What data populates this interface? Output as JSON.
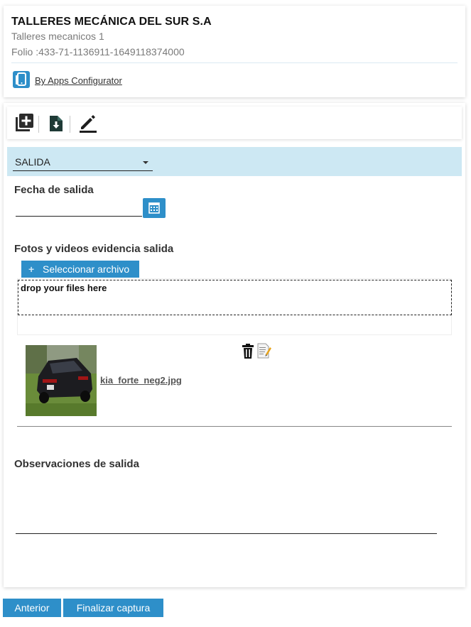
{
  "header": {
    "company_name": "TALLERES MECÁNICA DEL SUR S.A",
    "subtitle": "Talleres mecanicos 1",
    "folio": "Folio :433-71-1136911-1649118374000",
    "apps_link": "By Apps Configurator"
  },
  "toolbar": {
    "icons": [
      "add-box-icon",
      "download-file-icon",
      "edit-pen-icon"
    ]
  },
  "status": {
    "selected": "SALIDA"
  },
  "form": {
    "date_label": "Fecha de salida",
    "date_value": "",
    "photos_label": "Fotos y videos evidencia salida",
    "upload_button": "Seleccionar archivo",
    "dropzone_text": "drop your files here",
    "file_name": "kia_forte_neg2.jpg",
    "observations_label": "Observaciones de salida",
    "observations_value": ""
  },
  "footer": {
    "back_button": "Anterior",
    "finish_button": "Finalizar captura"
  },
  "colors": {
    "accent": "#2e8fc9",
    "status_bar": "#cde8f3"
  }
}
